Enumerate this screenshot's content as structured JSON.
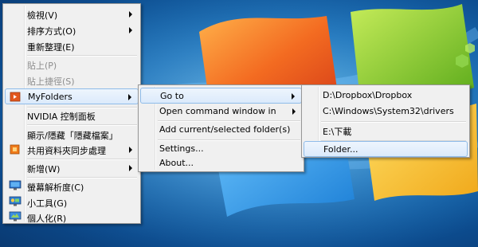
{
  "context_menu": {
    "items": [
      {
        "label": "檢視(V)",
        "submenu": true
      },
      {
        "label": "排序方式(O)",
        "submenu": true
      },
      {
        "label": "重新整理(E)"
      },
      {
        "label": "貼上(P)",
        "disabled": true
      },
      {
        "label": "貼上捷徑(S)",
        "disabled": true
      },
      {
        "label": "MyFolders",
        "submenu": true,
        "highlighted": true,
        "icon": "myfolders-icon"
      },
      {
        "label": "NVIDIA 控制面板"
      },
      {
        "label": "顯示/隱藏「隱藏檔案」"
      },
      {
        "label": "共用資料夾同步處理",
        "submenu": true,
        "icon": "sync-icon"
      },
      {
        "label": "新增(W)",
        "submenu": true
      },
      {
        "label": "螢幕解析度(C)",
        "icon": "display-icon"
      },
      {
        "label": "小工具(G)",
        "icon": "gadgets-icon"
      },
      {
        "label": "個人化(R)",
        "icon": "personalize-icon"
      }
    ]
  },
  "myfolders_menu": {
    "items": [
      {
        "label": "Go to",
        "submenu": true,
        "highlighted": true
      },
      {
        "label": "Open command window in",
        "submenu": true
      },
      {
        "label": "Add current/selected folder(s)"
      },
      {
        "label": "Settings..."
      },
      {
        "label": "About..."
      }
    ]
  },
  "goto_menu": {
    "items": [
      {
        "label": "D:\\Dropbox\\Dropbox"
      },
      {
        "label": "C:\\Windows\\System32\\drivers"
      },
      {
        "label": "E:\\下載"
      },
      {
        "label": "Folder...",
        "highlighted": true
      }
    ]
  },
  "colors": {
    "menu_bg": "#f0f0f0",
    "highlight_border": "#8fbce9",
    "desktop_blue": "#1d74bb"
  }
}
